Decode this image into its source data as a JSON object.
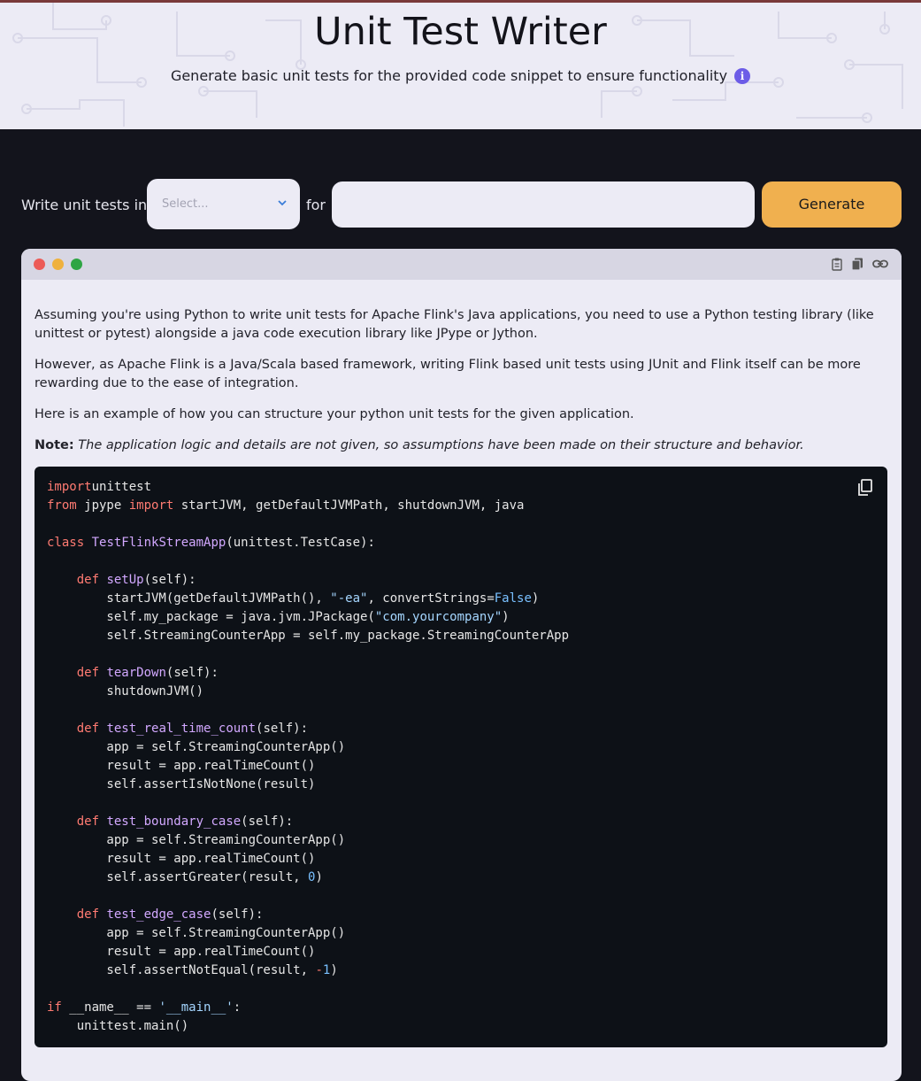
{
  "header": {
    "title": "Unit Test Writer",
    "subtitle": "Generate basic unit tests for the provided code snippet to ensure functionality",
    "info_icon": "i"
  },
  "form": {
    "label_write": "Write unit tests in",
    "select_placeholder": "Select...",
    "label_for": "for",
    "code_input_value": "",
    "generate_label": "Generate"
  },
  "result": {
    "toolbar_icons": [
      "clipboard-icon",
      "copy-icon",
      "link-icon"
    ],
    "para1": "Assuming you're using Python to write unit tests for Apache Flink's Java applications, you need to use a Python testing library (like unittest or pytest) alongside a java code execution library like JPype or Jython.",
    "para2": "However, as Apache Flink is a Java/Scala based framework, writing Flink based unit tests using JUnit and Flink itself can be more rewarding due to the ease of integration.",
    "para3": "Here is an example of how you can structure your python unit tests for the given application.",
    "note_label": "Note:",
    "note_text": "The application logic and details are not given, so assumptions have been made on their structure and behavior.",
    "code_lines": [
      [
        [
          "k",
          "import"
        ],
        [
          "",
          "unittest"
        ]
      ],
      [
        [
          "k",
          "from"
        ],
        [
          "",
          " jpype "
        ],
        [
          "k",
          "import"
        ],
        [
          "",
          " startJVM, getDefaultJVMPath, shutdownJVM, java"
        ]
      ],
      [],
      [
        [
          "k",
          "class"
        ],
        [
          "",
          " "
        ],
        [
          "f",
          "TestFlinkStreamApp"
        ],
        [
          "",
          "(unittest.TestCase):"
        ]
      ],
      [],
      [
        [
          "",
          "    "
        ],
        [
          "k",
          "def"
        ],
        [
          "",
          " "
        ],
        [
          "f",
          "setUp"
        ],
        [
          "",
          "(self):"
        ]
      ],
      [
        [
          "",
          "        startJVM(getDefaultJVMPath(), "
        ],
        [
          "s",
          "\"-ea\""
        ],
        [
          "",
          ", convertStrings="
        ],
        [
          "n",
          "False"
        ],
        [
          "",
          ")"
        ]
      ],
      [
        [
          "",
          "        self.my_package = java.jvm.JPackage("
        ],
        [
          "s",
          "\"com.yourcompany\""
        ],
        [
          "",
          ")"
        ]
      ],
      [
        [
          "",
          "        self.StreamingCounterApp = self.my_package.StreamingCounterApp"
        ]
      ],
      [],
      [
        [
          "",
          "    "
        ],
        [
          "k",
          "def"
        ],
        [
          "",
          " "
        ],
        [
          "f",
          "tearDown"
        ],
        [
          "",
          "(self):"
        ]
      ],
      [
        [
          "",
          "        shutdownJVM()"
        ]
      ],
      [],
      [
        [
          "",
          "    "
        ],
        [
          "k",
          "def"
        ],
        [
          "",
          " "
        ],
        [
          "f",
          "test_real_time_count"
        ],
        [
          "",
          "(self):"
        ]
      ],
      [
        [
          "",
          "        app = self.StreamingCounterApp()"
        ]
      ],
      [
        [
          "",
          "        result = app.realTimeCount()"
        ]
      ],
      [
        [
          "",
          "        self.assertIsNotNone(result)"
        ]
      ],
      [],
      [
        [
          "",
          "    "
        ],
        [
          "k",
          "def"
        ],
        [
          "",
          " "
        ],
        [
          "f",
          "test_boundary_case"
        ],
        [
          "",
          "(self):"
        ]
      ],
      [
        [
          "",
          "        app = self.StreamingCounterApp()"
        ]
      ],
      [
        [
          "",
          "        result = app.realTimeCount()"
        ]
      ],
      [
        [
          "",
          "        self.assertGreater(result, "
        ],
        [
          "n",
          "0"
        ],
        [
          "",
          ")"
        ]
      ],
      [],
      [
        [
          "",
          "    "
        ],
        [
          "k",
          "def"
        ],
        [
          "",
          " "
        ],
        [
          "f",
          "test_edge_case"
        ],
        [
          "",
          "(self):"
        ]
      ],
      [
        [
          "",
          "        app = self.StreamingCounterApp()"
        ]
      ],
      [
        [
          "",
          "        result = app.realTimeCount()"
        ]
      ],
      [
        [
          "",
          "        self.assertNotEqual(result, "
        ],
        [
          "k",
          "-"
        ],
        [
          "n",
          "1"
        ],
        [
          "",
          ")"
        ]
      ],
      [],
      [
        [
          "k",
          "if"
        ],
        [
          "",
          " __name__ == "
        ],
        [
          "s",
          "'__main__'"
        ],
        [
          "",
          ":"
        ]
      ],
      [
        [
          "",
          "    unittest.main()"
        ]
      ]
    ]
  },
  "colors": {
    "accent": "#f0b04f",
    "info": "#6c5ce7",
    "page_bg": "#13141c",
    "panel_bg": "#ecebf5",
    "code_bg": "#0d1117"
  }
}
